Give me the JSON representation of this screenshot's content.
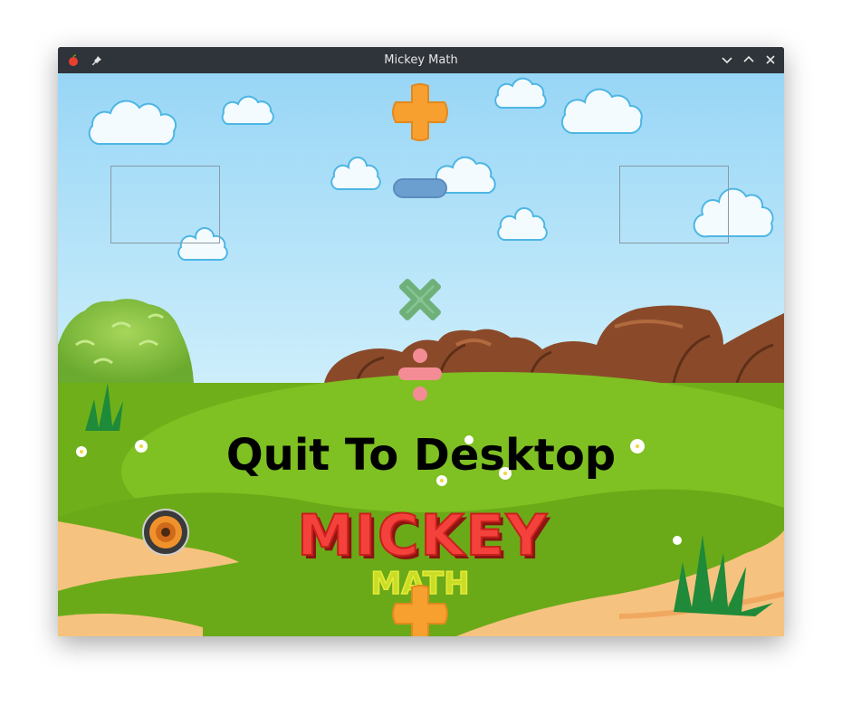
{
  "window": {
    "title": "Mickey Math",
    "left_icons": [
      "app-apple-icon",
      "pin-icon"
    ],
    "right_buttons": [
      "minimize-button",
      "maximize-button",
      "close-button"
    ]
  },
  "menu": {
    "quit_label": "Quit To Desktop"
  },
  "logo": {
    "line1": "MICKEY",
    "line2": "MATH"
  },
  "operators": [
    {
      "name": "plus-operator",
      "color": "#f7a030"
    },
    {
      "name": "minus-operator",
      "color": "#6b9fcf"
    },
    {
      "name": "multiply-operator",
      "color": "#86c58f"
    },
    {
      "name": "divide-operator",
      "color": "#f48c95"
    }
  ],
  "colors": {
    "sky_top": "#9ad8f7",
    "sky_bottom": "#c9ecfb",
    "grass": "#7dbb1e",
    "sand": "#f6c27f",
    "rock": "#8a4a2a"
  }
}
